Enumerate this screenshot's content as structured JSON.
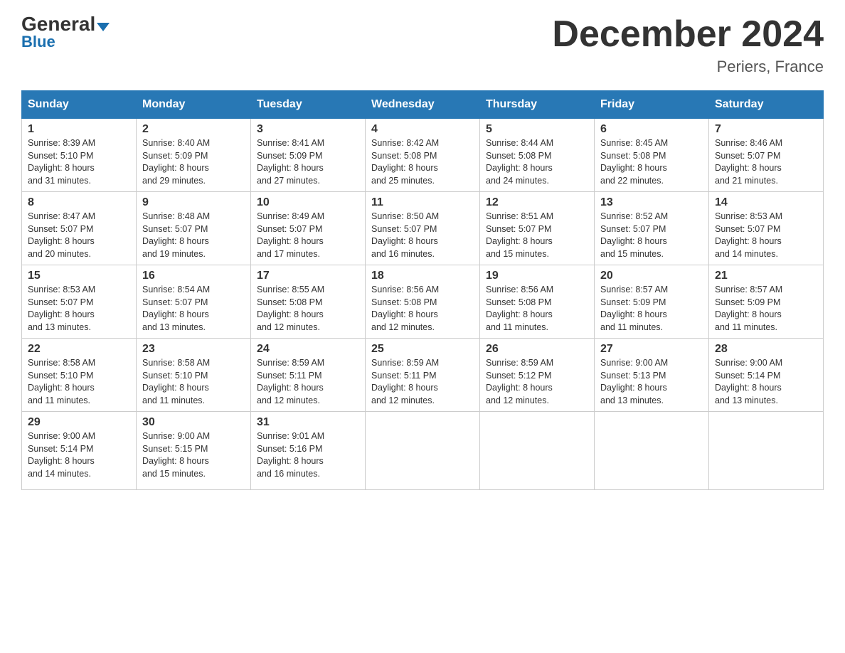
{
  "header": {
    "logo_general": "General",
    "logo_blue": "Blue",
    "month_title": "December 2024",
    "location": "Periers, France"
  },
  "days_of_week": [
    "Sunday",
    "Monday",
    "Tuesday",
    "Wednesday",
    "Thursday",
    "Friday",
    "Saturday"
  ],
  "weeks": [
    [
      {
        "day": "1",
        "info": "Sunrise: 8:39 AM\nSunset: 5:10 PM\nDaylight: 8 hours\nand 31 minutes."
      },
      {
        "day": "2",
        "info": "Sunrise: 8:40 AM\nSunset: 5:09 PM\nDaylight: 8 hours\nand 29 minutes."
      },
      {
        "day": "3",
        "info": "Sunrise: 8:41 AM\nSunset: 5:09 PM\nDaylight: 8 hours\nand 27 minutes."
      },
      {
        "day": "4",
        "info": "Sunrise: 8:42 AM\nSunset: 5:08 PM\nDaylight: 8 hours\nand 25 minutes."
      },
      {
        "day": "5",
        "info": "Sunrise: 8:44 AM\nSunset: 5:08 PM\nDaylight: 8 hours\nand 24 minutes."
      },
      {
        "day": "6",
        "info": "Sunrise: 8:45 AM\nSunset: 5:08 PM\nDaylight: 8 hours\nand 22 minutes."
      },
      {
        "day": "7",
        "info": "Sunrise: 8:46 AM\nSunset: 5:07 PM\nDaylight: 8 hours\nand 21 minutes."
      }
    ],
    [
      {
        "day": "8",
        "info": "Sunrise: 8:47 AM\nSunset: 5:07 PM\nDaylight: 8 hours\nand 20 minutes."
      },
      {
        "day": "9",
        "info": "Sunrise: 8:48 AM\nSunset: 5:07 PM\nDaylight: 8 hours\nand 19 minutes."
      },
      {
        "day": "10",
        "info": "Sunrise: 8:49 AM\nSunset: 5:07 PM\nDaylight: 8 hours\nand 17 minutes."
      },
      {
        "day": "11",
        "info": "Sunrise: 8:50 AM\nSunset: 5:07 PM\nDaylight: 8 hours\nand 16 minutes."
      },
      {
        "day": "12",
        "info": "Sunrise: 8:51 AM\nSunset: 5:07 PM\nDaylight: 8 hours\nand 15 minutes."
      },
      {
        "day": "13",
        "info": "Sunrise: 8:52 AM\nSunset: 5:07 PM\nDaylight: 8 hours\nand 15 minutes."
      },
      {
        "day": "14",
        "info": "Sunrise: 8:53 AM\nSunset: 5:07 PM\nDaylight: 8 hours\nand 14 minutes."
      }
    ],
    [
      {
        "day": "15",
        "info": "Sunrise: 8:53 AM\nSunset: 5:07 PM\nDaylight: 8 hours\nand 13 minutes."
      },
      {
        "day": "16",
        "info": "Sunrise: 8:54 AM\nSunset: 5:07 PM\nDaylight: 8 hours\nand 13 minutes."
      },
      {
        "day": "17",
        "info": "Sunrise: 8:55 AM\nSunset: 5:08 PM\nDaylight: 8 hours\nand 12 minutes."
      },
      {
        "day": "18",
        "info": "Sunrise: 8:56 AM\nSunset: 5:08 PM\nDaylight: 8 hours\nand 12 minutes."
      },
      {
        "day": "19",
        "info": "Sunrise: 8:56 AM\nSunset: 5:08 PM\nDaylight: 8 hours\nand 11 minutes."
      },
      {
        "day": "20",
        "info": "Sunrise: 8:57 AM\nSunset: 5:09 PM\nDaylight: 8 hours\nand 11 minutes."
      },
      {
        "day": "21",
        "info": "Sunrise: 8:57 AM\nSunset: 5:09 PM\nDaylight: 8 hours\nand 11 minutes."
      }
    ],
    [
      {
        "day": "22",
        "info": "Sunrise: 8:58 AM\nSunset: 5:10 PM\nDaylight: 8 hours\nand 11 minutes."
      },
      {
        "day": "23",
        "info": "Sunrise: 8:58 AM\nSunset: 5:10 PM\nDaylight: 8 hours\nand 11 minutes."
      },
      {
        "day": "24",
        "info": "Sunrise: 8:59 AM\nSunset: 5:11 PM\nDaylight: 8 hours\nand 12 minutes."
      },
      {
        "day": "25",
        "info": "Sunrise: 8:59 AM\nSunset: 5:11 PM\nDaylight: 8 hours\nand 12 minutes."
      },
      {
        "day": "26",
        "info": "Sunrise: 8:59 AM\nSunset: 5:12 PM\nDaylight: 8 hours\nand 12 minutes."
      },
      {
        "day": "27",
        "info": "Sunrise: 9:00 AM\nSunset: 5:13 PM\nDaylight: 8 hours\nand 13 minutes."
      },
      {
        "day": "28",
        "info": "Sunrise: 9:00 AM\nSunset: 5:14 PM\nDaylight: 8 hours\nand 13 minutes."
      }
    ],
    [
      {
        "day": "29",
        "info": "Sunrise: 9:00 AM\nSunset: 5:14 PM\nDaylight: 8 hours\nand 14 minutes."
      },
      {
        "day": "30",
        "info": "Sunrise: 9:00 AM\nSunset: 5:15 PM\nDaylight: 8 hours\nand 15 minutes."
      },
      {
        "day": "31",
        "info": "Sunrise: 9:01 AM\nSunset: 5:16 PM\nDaylight: 8 hours\nand 16 minutes."
      },
      {
        "day": "",
        "info": ""
      },
      {
        "day": "",
        "info": ""
      },
      {
        "day": "",
        "info": ""
      },
      {
        "day": "",
        "info": ""
      }
    ]
  ]
}
